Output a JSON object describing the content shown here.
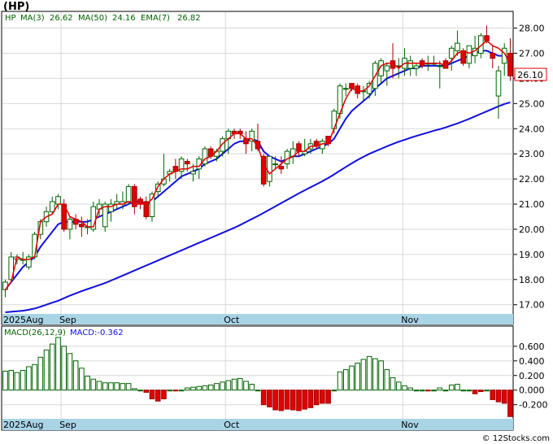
{
  "title": "(HP)",
  "watermark": "© 12Stocks.com",
  "legend": {
    "symbol": "HP",
    "ma3": "MA(3)",
    "ma3_value": "26.62",
    "ma50": "MA(50)",
    "ma50_value": "24.16",
    "ema7": "EMA(7)",
    "ema7_value": "26.82"
  },
  "macd_legend": {
    "label": "MACD(26,12,9)",
    "value_label": "MACD:-0.362"
  },
  "last_price_label": "26.10",
  "colors": {
    "up_fill": "#ffffff",
    "up_stroke": "#006400",
    "down_fill": "#e00000",
    "down_stroke": "#a00000",
    "ma50": "#1010e0",
    "ema7": "#1010e0",
    "ma3": "#e00000",
    "axis_band": "#a8d4e6",
    "grid": "#d8d8d8"
  },
  "chart_data": [
    {
      "type": "candlestick",
      "ylim": [
        16.7,
        28.6
      ],
      "y_ticks": [
        "28.00",
        "27.00",
        "26.00",
        "25.00",
        "24.00",
        "23.00",
        "22.00",
        "21.00",
        "20.00",
        "19.00",
        "18.00",
        "17.00"
      ],
      "x_labels": [
        "2025Aug",
        "Sep",
        "Oct",
        "Nov"
      ],
      "ohlc": [
        [
          17.6,
          18.0,
          17.3,
          17.9
        ],
        [
          18.0,
          19.1,
          17.9,
          18.9
        ],
        [
          18.8,
          19.0,
          18.6,
          18.9
        ],
        [
          18.8,
          19.1,
          18.6,
          18.8
        ],
        [
          18.5,
          19.0,
          18.4,
          18.9
        ],
        [
          18.9,
          19.9,
          18.8,
          19.8
        ],
        [
          19.8,
          20.4,
          19.6,
          20.3
        ],
        [
          20.3,
          20.9,
          20.1,
          20.7
        ],
        [
          20.7,
          21.3,
          20.6,
          21.1
        ],
        [
          21.0,
          21.4,
          20.8,
          21.3
        ],
        [
          21.0,
          21.2,
          19.9,
          20.0
        ],
        [
          20.0,
          20.5,
          19.6,
          20.4
        ],
        [
          20.4,
          20.6,
          20.0,
          20.2
        ],
        [
          20.2,
          20.5,
          19.7,
          20.1
        ],
        [
          20.1,
          20.4,
          19.8,
          20.1
        ],
        [
          20.0,
          21.1,
          19.9,
          20.9
        ],
        [
          20.8,
          21.2,
          20.5,
          21.0
        ],
        [
          20.1,
          21.1,
          19.9,
          21.0
        ],
        [
          20.7,
          21.2,
          20.3,
          21.0
        ],
        [
          21.0,
          21.4,
          20.8,
          21.1
        ],
        [
          21.0,
          21.5,
          20.8,
          21.1
        ],
        [
          21.1,
          21.8,
          21.0,
          21.7
        ],
        [
          21.7,
          21.8,
          20.6,
          20.9
        ],
        [
          21.2,
          21.3,
          20.8,
          21.0
        ],
        [
          21.1,
          21.3,
          20.4,
          20.5
        ],
        [
          20.5,
          21.5,
          20.3,
          21.4
        ],
        [
          21.5,
          21.9,
          21.3,
          21.8
        ],
        [
          21.8,
          23.0,
          21.7,
          22.0
        ],
        [
          22.2,
          22.4,
          21.9,
          22.3
        ],
        [
          22.5,
          22.8,
          22.0,
          22.3
        ],
        [
          22.3,
          22.9,
          22.0,
          22.8
        ],
        [
          22.7,
          22.8,
          22.3,
          22.6
        ],
        [
          22.2,
          22.6,
          21.9,
          22.3
        ],
        [
          22.4,
          22.9,
          22.0,
          22.8
        ],
        [
          22.6,
          23.3,
          22.5,
          23.2
        ],
        [
          23.2,
          23.3,
          22.8,
          22.9
        ],
        [
          22.9,
          23.2,
          22.7,
          23.1
        ],
        [
          23.1,
          23.7,
          22.9,
          23.6
        ],
        [
          23.6,
          24.0,
          23.0,
          23.9
        ],
        [
          23.9,
          24.0,
          23.6,
          23.8
        ],
        [
          23.9,
          24.0,
          23.6,
          23.8
        ],
        [
          23.6,
          23.9,
          23.0,
          23.4
        ],
        [
          23.5,
          24.0,
          23.1,
          23.9
        ],
        [
          23.5,
          24.2,
          23.1,
          23.2
        ],
        [
          22.9,
          23.0,
          21.7,
          21.8
        ],
        [
          21.9,
          22.9,
          21.7,
          22.9
        ],
        [
          22.6,
          22.9,
          22.4,
          22.6
        ],
        [
          22.5,
          22.9,
          22.2,
          22.4
        ],
        [
          22.6,
          23.2,
          22.4,
          23.1
        ],
        [
          22.9,
          23.5,
          22.6,
          23.2
        ],
        [
          23.4,
          23.5,
          22.9,
          23.1
        ],
        [
          23.0,
          23.6,
          22.9,
          23.1
        ],
        [
          23.2,
          23.6,
          23.0,
          23.4
        ],
        [
          23.5,
          23.6,
          23.2,
          23.3
        ],
        [
          23.2,
          23.6,
          23.0,
          23.5
        ],
        [
          23.7,
          23.7,
          23.3,
          23.4
        ],
        [
          24.0,
          24.8,
          23.8,
          24.7
        ],
        [
          24.6,
          25.8,
          24.4,
          25.7
        ],
        [
          25.6,
          25.8,
          25.3,
          25.6
        ],
        [
          25.8,
          25.8,
          25.5,
          25.6
        ],
        [
          25.7,
          25.8,
          25.2,
          25.4
        ],
        [
          25.5,
          25.7,
          25.1,
          25.5
        ],
        [
          25.4,
          25.9,
          25.2,
          25.8
        ],
        [
          25.6,
          26.7,
          25.3,
          26.6
        ],
        [
          26.1,
          26.8,
          25.8,
          26.7
        ],
        [
          26.3,
          26.6,
          25.7,
          26.5
        ],
        [
          26.7,
          27.4,
          26.0,
          26.4
        ],
        [
          26.5,
          26.8,
          26.0,
          26.5
        ],
        [
          26.4,
          27.2,
          26.1,
          26.8
        ],
        [
          26.4,
          26.9,
          26.1,
          26.7
        ],
        [
          26.4,
          26.6,
          26.1,
          26.5
        ],
        [
          26.7,
          26.8,
          26.4,
          26.5
        ],
        [
          26.6,
          26.9,
          26.3,
          26.6
        ],
        [
          26.6,
          26.9,
          26.5,
          26.6
        ],
        [
          26.5,
          26.7,
          25.6,
          26.5
        ],
        [
          26.7,
          26.8,
          26.4,
          26.4
        ],
        [
          26.8,
          27.3,
          26.3,
          27.2
        ],
        [
          27.1,
          27.9,
          26.9,
          27.4
        ],
        [
          27.1,
          27.2,
          26.5,
          26.6
        ],
        [
          26.6,
          27.3,
          26.4,
          27.3
        ],
        [
          26.9,
          27.7,
          26.6,
          27.2
        ],
        [
          27.0,
          27.8,
          26.8,
          27.7
        ],
        [
          27.7,
          28.1,
          27.4,
          27.5
        ],
        [
          27.0,
          27.3,
          26.4,
          26.8
        ],
        [
          25.3,
          26.5,
          24.4,
          26.3
        ],
        [
          26.6,
          27.4,
          26.1,
          27.2
        ],
        [
          27.0,
          27.6,
          25.9,
          26.1
        ]
      ],
      "ma3": [
        17.6,
        17.9,
        18.9,
        18.8,
        18.8,
        18.9,
        20.3,
        20.5,
        20.6,
        21.0,
        21.0,
        20.5,
        20.4,
        20.3,
        20.1,
        20.1,
        20.8,
        20.9,
        20.9,
        21.0,
        21.0,
        21.1,
        21.0,
        21.0,
        21.0,
        21.2,
        21.7,
        22.0,
        22.2,
        22.3,
        22.4,
        22.4,
        22.5,
        22.5,
        22.8,
        22.9,
        23.1,
        23.4,
        23.6,
        23.8,
        23.8,
        23.6,
        23.6,
        23.3,
        22.6,
        22.2,
        22.4,
        22.6,
        22.8,
        22.9,
        23.1,
        23.1,
        23.3,
        23.3,
        23.4,
        23.4,
        24.0,
        24.6,
        25.2,
        25.6,
        25.5,
        25.5,
        25.7,
        26.1,
        26.5,
        26.6,
        26.6,
        26.4,
        26.6,
        26.6,
        26.6,
        26.6,
        26.6,
        26.6,
        26.6,
        26.5,
        26.7,
        27.0,
        27.1,
        27.0,
        27.1,
        27.3,
        27.5,
        27.3,
        27.2,
        27.0,
        26.6
      ],
      "ema7": [
        17.6,
        17.9,
        18.2,
        18.5,
        18.7,
        18.9,
        19.3,
        19.6,
        19.9,
        20.2,
        20.3,
        20.3,
        20.3,
        20.3,
        20.3,
        20.4,
        20.5,
        20.6,
        20.7,
        20.8,
        20.9,
        21.0,
        21.1,
        21.1,
        21.0,
        21.1,
        21.3,
        21.5,
        21.7,
        21.9,
        22.1,
        22.2,
        22.3,
        22.4,
        22.6,
        22.7,
        22.8,
        23.0,
        23.2,
        23.4,
        23.5,
        23.5,
        23.6,
        23.5,
        23.1,
        22.9,
        22.8,
        22.7,
        22.8,
        22.9,
        22.9,
        23.0,
        23.1,
        23.2,
        23.3,
        23.4,
        23.6,
        24.0,
        24.4,
        24.7,
        24.9,
        25.1,
        25.3,
        25.6,
        25.8,
        26.0,
        26.1,
        26.2,
        26.3,
        26.4,
        26.4,
        26.5,
        26.5,
        26.5,
        26.5,
        26.5,
        26.6,
        26.7,
        26.8,
        26.9,
        27.0,
        27.1,
        27.1,
        27.0,
        26.9,
        26.9,
        26.8
      ],
      "ma50": [
        16.7,
        16.72,
        16.74,
        16.76,
        16.8,
        16.85,
        16.92,
        17.0,
        17.08,
        17.16,
        17.26,
        17.36,
        17.45,
        17.54,
        17.62,
        17.7,
        17.78,
        17.86,
        17.96,
        18.06,
        18.16,
        18.26,
        18.36,
        18.46,
        18.56,
        18.66,
        18.76,
        18.86,
        18.96,
        19.06,
        19.16,
        19.26,
        19.36,
        19.46,
        19.56,
        19.66,
        19.76,
        19.86,
        19.96,
        20.06,
        20.17,
        20.29,
        20.41,
        20.53,
        20.65,
        20.78,
        20.91,
        21.04,
        21.17,
        21.3,
        21.43,
        21.55,
        21.67,
        21.79,
        21.91,
        22.04,
        22.18,
        22.33,
        22.48,
        22.62,
        22.76,
        22.88,
        23.0,
        23.1,
        23.2,
        23.3,
        23.39,
        23.48,
        23.56,
        23.64,
        23.71,
        23.78,
        23.85,
        23.92,
        23.98,
        24.05,
        24.13,
        24.21,
        24.3,
        24.39,
        24.49,
        24.59,
        24.69,
        24.79,
        24.89,
        24.98,
        25.05
      ]
    },
    {
      "type": "bar",
      "series_label": "MACD",
      "ylim": [
        -0.37,
        0.72
      ],
      "y_ticks": [
        "0.600",
        "0.400",
        "0.200",
        "0.000",
        "-0.200"
      ],
      "x_labels": [
        "2025Aug",
        "Sep",
        "Oct",
        "Nov"
      ],
      "values": [
        0.26,
        0.27,
        0.24,
        0.27,
        0.32,
        0.35,
        0.45,
        0.55,
        0.63,
        0.72,
        0.6,
        0.5,
        0.4,
        0.3,
        0.19,
        0.15,
        0.12,
        0.1,
        0.1,
        0.1,
        0.09,
        0.09,
        0.02,
        0.0,
        -0.03,
        -0.12,
        -0.15,
        -0.12,
        0.0,
        -0.01,
        0.0,
        0.03,
        0.04,
        0.05,
        0.06,
        0.07,
        0.09,
        0.11,
        0.13,
        0.15,
        0.16,
        0.12,
        0.08,
        0.0,
        -0.2,
        -0.23,
        -0.27,
        -0.28,
        -0.26,
        -0.27,
        -0.28,
        -0.26,
        -0.24,
        -0.2,
        -0.18,
        -0.18,
        0.0,
        0.25,
        0.28,
        0.33,
        0.37,
        0.42,
        0.46,
        0.43,
        0.4,
        0.28,
        0.17,
        0.11,
        0.06,
        0.03,
        0.0,
        0.0,
        -0.01,
        0.0,
        0.03,
        0.0,
        0.07,
        0.08,
        0.0,
        0.0,
        -0.05,
        -0.02,
        0.0,
        -0.13,
        -0.16,
        -0.18,
        -0.362
      ]
    }
  ]
}
